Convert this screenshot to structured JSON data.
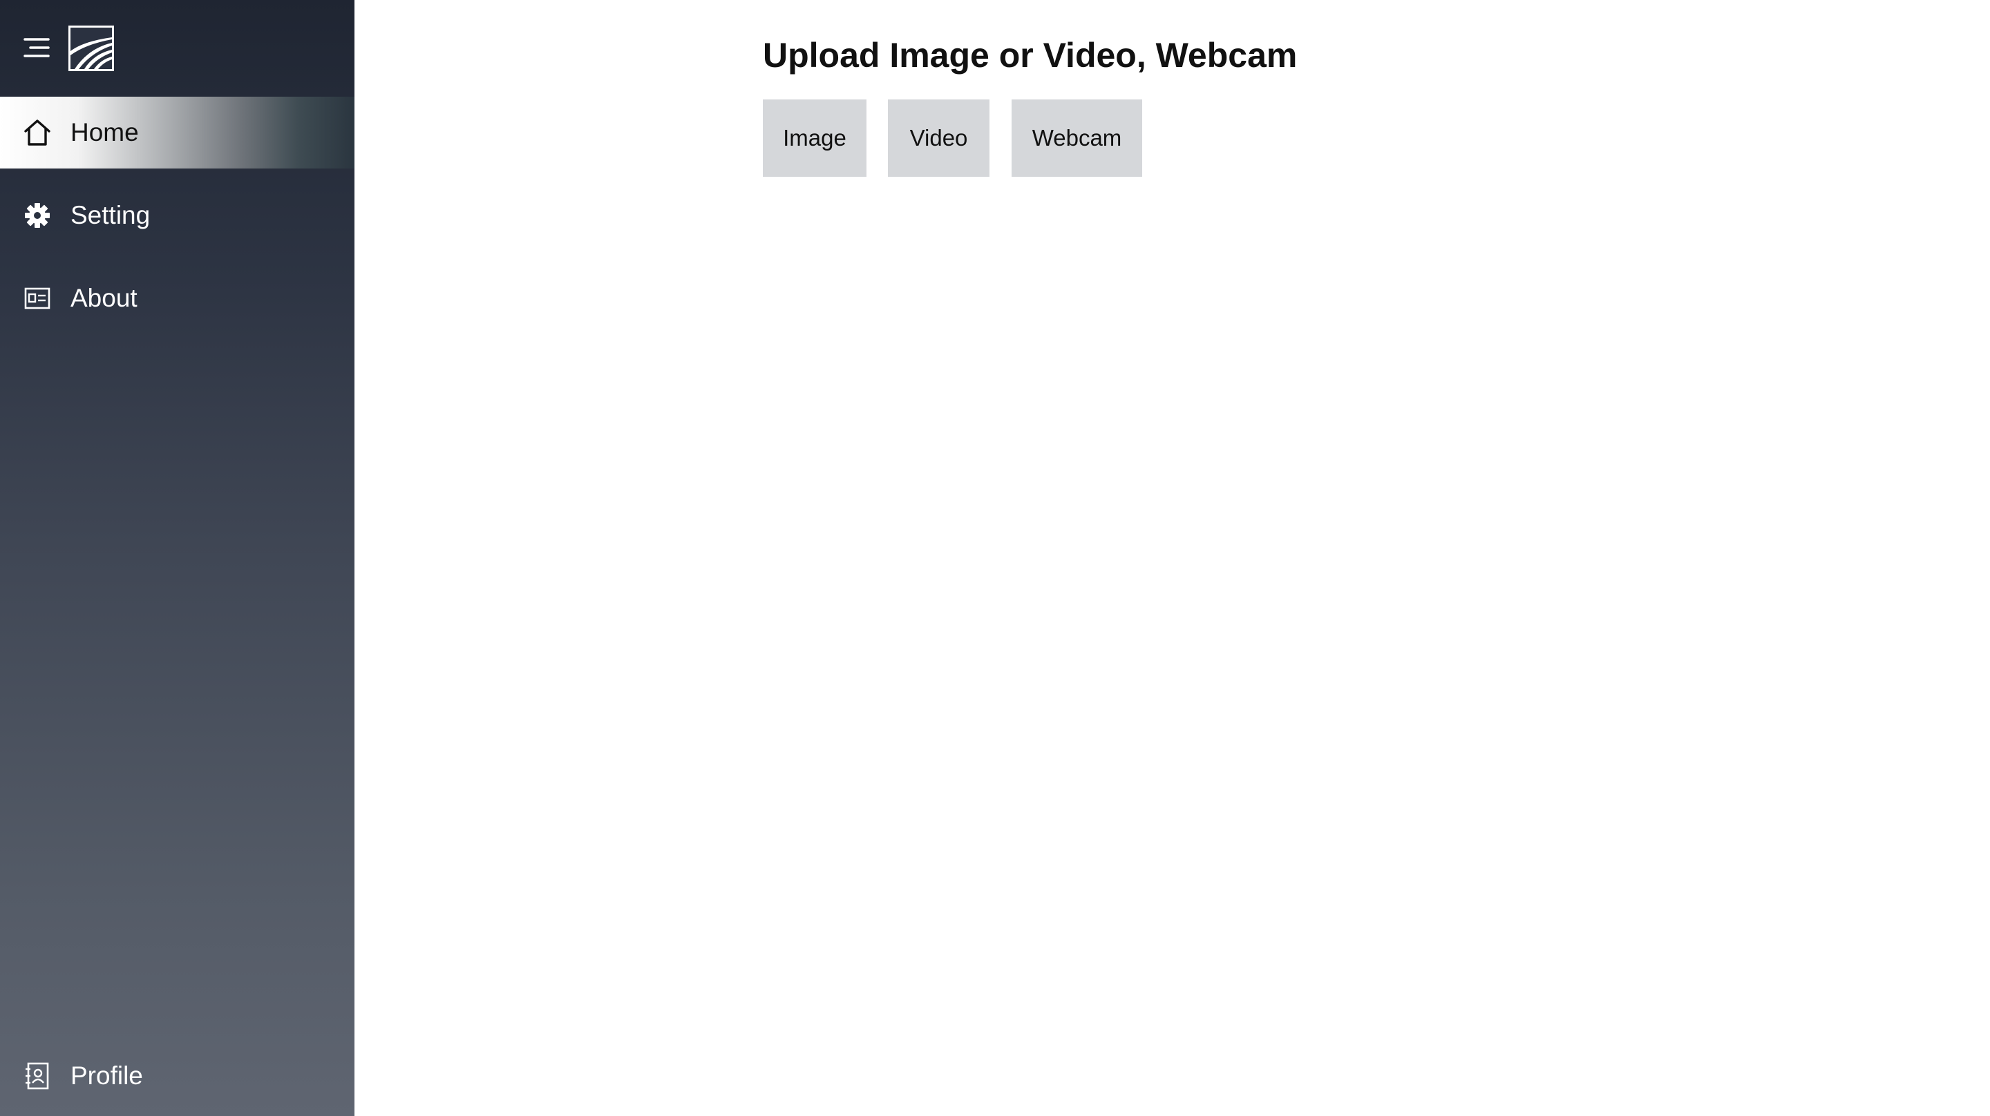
{
  "sidebar": {
    "items": [
      {
        "label": "Home",
        "icon": "home-icon",
        "active": true
      },
      {
        "label": "Setting",
        "icon": "gear-icon",
        "active": false
      },
      {
        "label": "About",
        "icon": "id-card-icon",
        "active": false
      }
    ],
    "profile": {
      "label": "Profile",
      "icon": "contact-book-icon"
    }
  },
  "main": {
    "title": "Upload Image or Video, Webcam",
    "buttons": {
      "image": "Image",
      "video": "Video",
      "webcam": "Webcam"
    }
  },
  "colors": {
    "sidebar_top": "#1f2532",
    "sidebar_bottom": "#5f6571",
    "button_bg": "#d5d7da",
    "active_item_start": "#ffffff"
  }
}
